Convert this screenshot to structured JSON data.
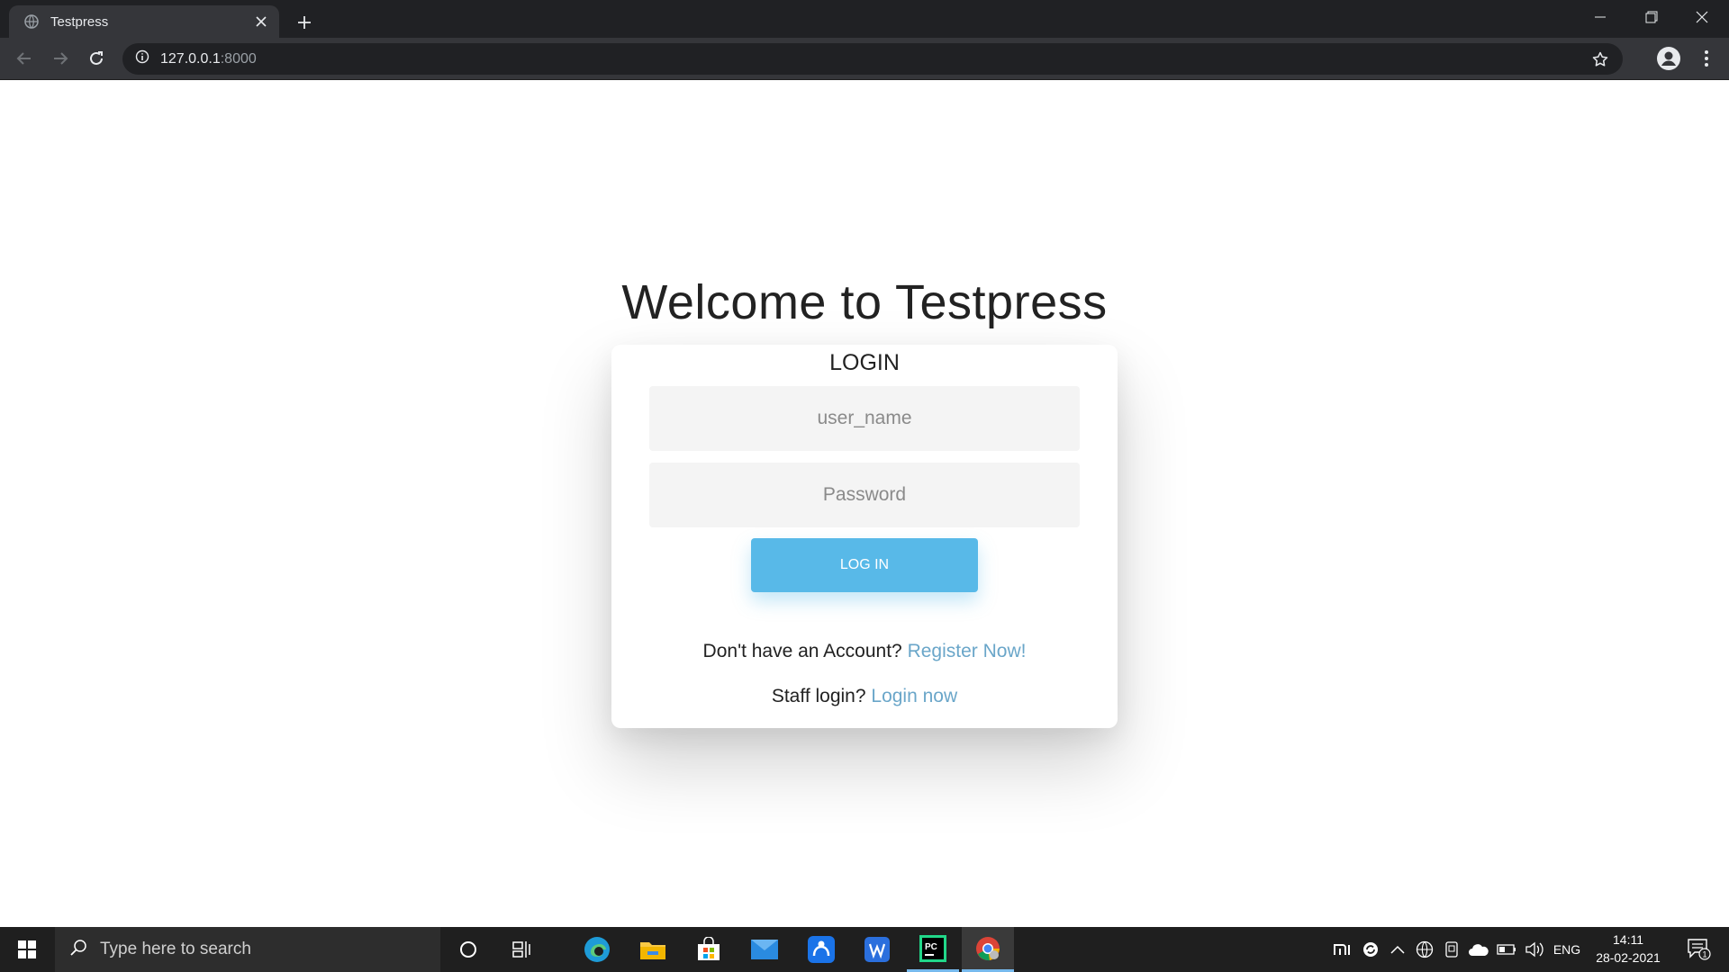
{
  "browser": {
    "tab_title": "Testpress",
    "url_host": "127.0.0.1",
    "url_port": ":8000"
  },
  "page": {
    "heading": "Welcome to Testpress",
    "login_card": {
      "title": "LOGIN",
      "username_placeholder": "user_name",
      "password_placeholder": "Password",
      "login_button": "LOG IN",
      "register_prompt": "Don't have an Account?",
      "register_link": "Register Now!",
      "staff_prompt": "Staff login?",
      "staff_link": "Login now"
    }
  },
  "taskbar": {
    "search_placeholder": "Type here to search",
    "language": "ENG",
    "time": "14:11",
    "date": "28-02-2021",
    "notification_count": "1",
    "apps": [
      "cortana-icon",
      "task-view-icon",
      "edge-icon",
      "file-explorer-icon",
      "store-icon",
      "mail-icon",
      "remote-access-icon",
      "wps-writer-icon",
      "pycharm-icon",
      "chrome-icon"
    ]
  },
  "colors": {
    "accent": "#58b9e8",
    "link": "#6aa6c9",
    "chrome_dark": "#202124",
    "chrome_toolbar": "#35363a"
  }
}
